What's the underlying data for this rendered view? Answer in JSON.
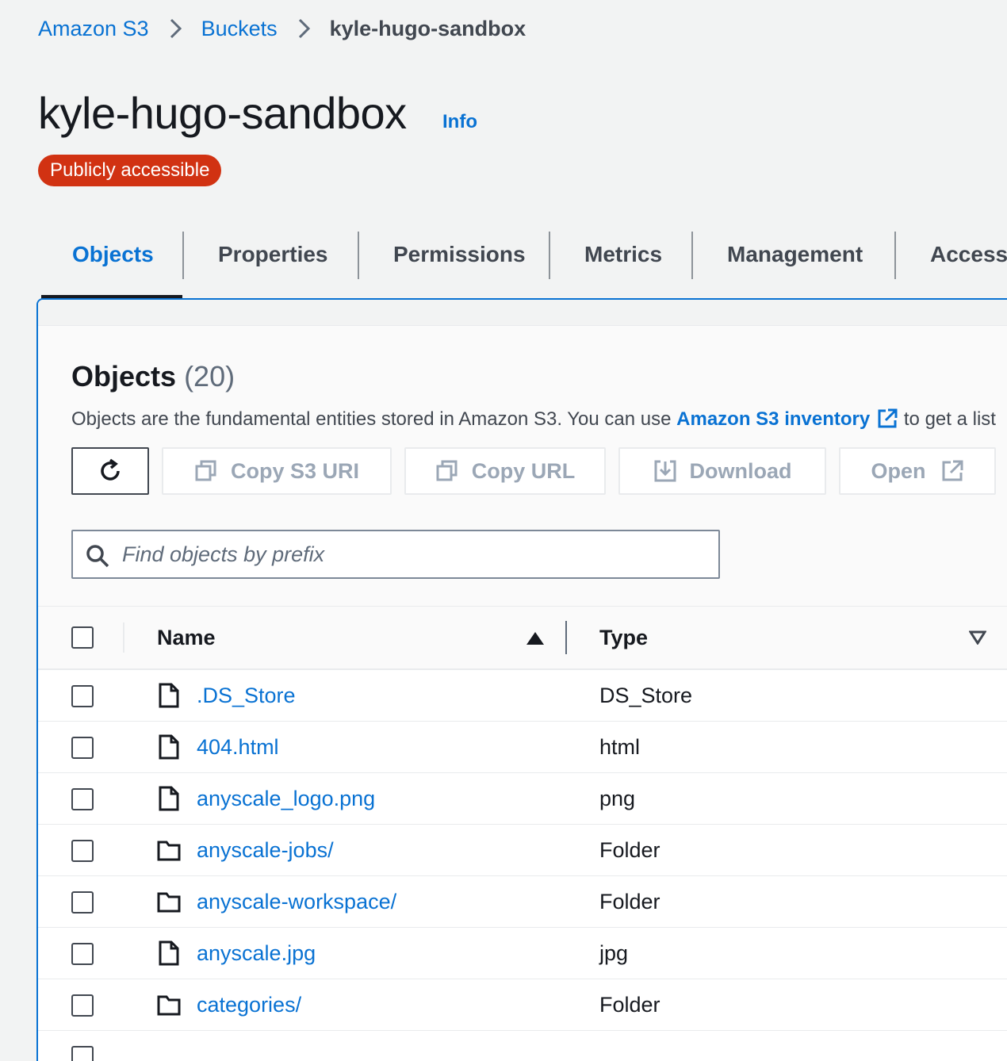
{
  "breadcrumb": {
    "items": [
      "Amazon S3",
      "Buckets"
    ],
    "current": "kyle-hugo-sandbox"
  },
  "header": {
    "title": "kyle-hugo-sandbox",
    "info": "Info",
    "badge": "Publicly accessible"
  },
  "tabs": [
    {
      "label": "Objects",
      "active": true
    },
    {
      "label": "Properties"
    },
    {
      "label": "Permissions"
    },
    {
      "label": "Metrics"
    },
    {
      "label": "Management"
    },
    {
      "label": "Access P"
    }
  ],
  "objects": {
    "title": "Objects",
    "count": "(20)",
    "description_prefix": "Objects are the fundamental entities stored in Amazon S3. You can use",
    "description_link": "Amazon S3 inventory",
    "description_suffix": "to get a list",
    "toolbar": {
      "copy_s3_uri": "Copy S3 URI",
      "copy_url": "Copy URL",
      "download": "Download",
      "open": "Open"
    },
    "search_placeholder": "Find objects by prefix",
    "columns": {
      "name": "Name",
      "type": "Type"
    },
    "rows": [
      {
        "name": ".DS_Store",
        "type": "DS_Store",
        "icon": "file-icon"
      },
      {
        "name": "404.html",
        "type": "html",
        "icon": "file-icon"
      },
      {
        "name": "anyscale_logo.png",
        "type": "png",
        "icon": "file-icon"
      },
      {
        "name": "anyscale-jobs/",
        "type": "Folder",
        "icon": "folder-icon"
      },
      {
        "name": "anyscale-workspace/",
        "type": "Folder",
        "icon": "folder-icon"
      },
      {
        "name": "anyscale.jpg",
        "type": "jpg",
        "icon": "file-icon"
      },
      {
        "name": "categories/",
        "type": "Folder",
        "icon": "folder-icon"
      }
    ]
  },
  "colors": {
    "link": "#0972d3",
    "badge": "#d13212",
    "text": "#16191f",
    "disabled": "#9ba7b6"
  }
}
